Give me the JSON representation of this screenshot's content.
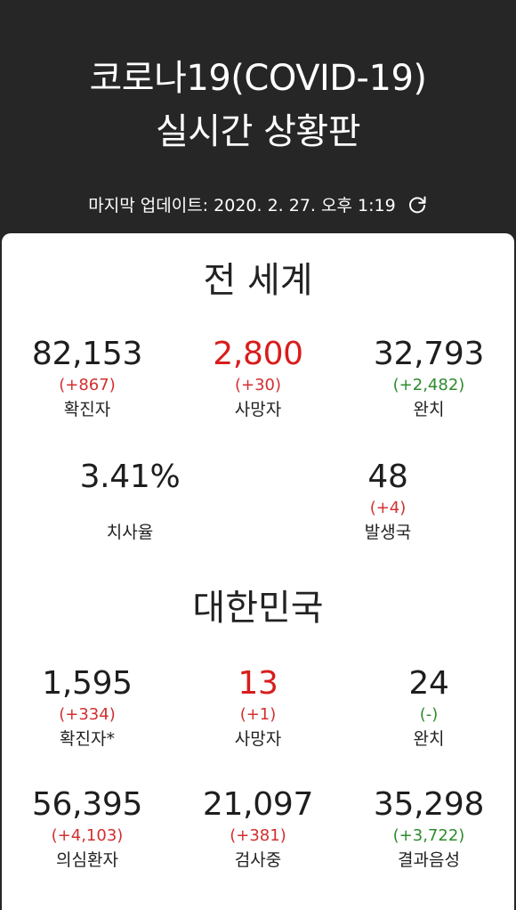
{
  "header": {
    "title_line1": "코로나19(COVID-19)",
    "title_line2": "실시간 상황판",
    "updated_label": "마지막 업데이트:",
    "updated_time": "2020. 2. 27. 오후 1:19",
    "refresh_icon": "refresh-icon"
  },
  "colors": {
    "header_bg": "#262626",
    "card_bg": "#ffffff",
    "red": "#d91c1c",
    "green": "#2e8b2e"
  },
  "world": {
    "title": "전 세계",
    "confirmed": {
      "value": "82,153",
      "delta": "(+867)",
      "label": "확진자"
    },
    "deaths": {
      "value": "2,800",
      "delta": "(+30)",
      "label": "사망자"
    },
    "recovered": {
      "value": "32,793",
      "delta": "(+2,482)",
      "label": "완치"
    },
    "fatality": {
      "value": "3.41%",
      "label": "치사율"
    },
    "countries": {
      "value": "48",
      "delta": "(+4)",
      "label": "발생국"
    }
  },
  "korea": {
    "title": "대한민국",
    "confirmed": {
      "value": "1,595",
      "delta": "(+334)",
      "label": "확진자*"
    },
    "deaths": {
      "value": "13",
      "delta": "(+1)",
      "label": "사망자"
    },
    "recovered": {
      "value": "24",
      "delta": "(-)",
      "label": "완치"
    },
    "suspected": {
      "value": "56,395",
      "delta": "(+4,103)",
      "label": "의심환자"
    },
    "testing": {
      "value": "21,097",
      "delta": "(+381)",
      "label": "검사중"
    },
    "negative": {
      "value": "35,298",
      "delta": "(+3,722)",
      "label": "결과음성"
    }
  }
}
